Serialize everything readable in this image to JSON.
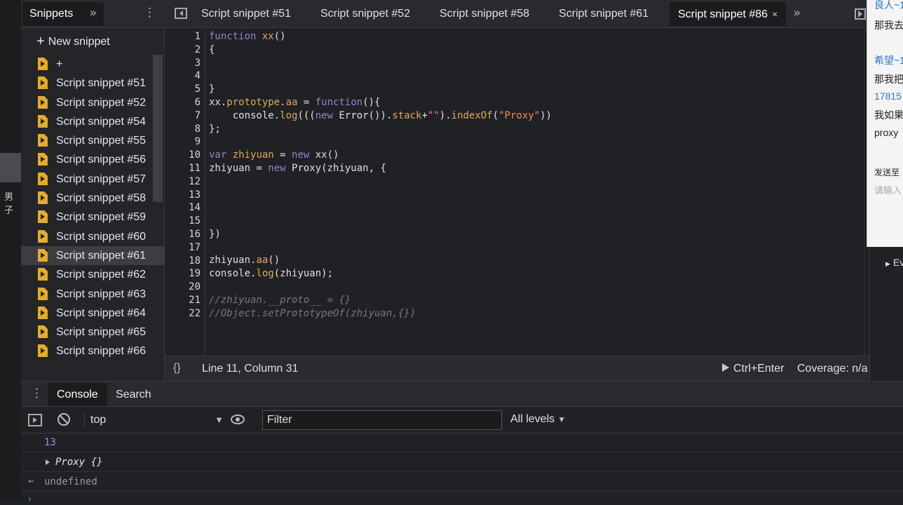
{
  "left_strip": {
    "text": "男子"
  },
  "sidebar": {
    "tab_label": "Snippets",
    "more_label": "»",
    "menu_label": "⋮",
    "new_snippet_label": "New snippet",
    "new_snippet_plus": "+",
    "items": [
      {
        "label": "+"
      },
      {
        "label": "Script snippet #51"
      },
      {
        "label": "Script snippet #52"
      },
      {
        "label": "Script snippet #54"
      },
      {
        "label": "Script snippet #55"
      },
      {
        "label": "Script snippet #56"
      },
      {
        "label": "Script snippet #57"
      },
      {
        "label": "Script snippet #58"
      },
      {
        "label": "Script snippet #59"
      },
      {
        "label": "Script snippet #60"
      },
      {
        "label": "Script snippet #61"
      },
      {
        "label": "Script snippet #62"
      },
      {
        "label": "Script snippet #63"
      },
      {
        "label": "Script snippet #64"
      },
      {
        "label": "Script snippet #65"
      },
      {
        "label": "Script snippet #66"
      }
    ],
    "active_item": "Script snippet #61"
  },
  "editor_tabs": {
    "tabs": [
      {
        "label": "Script snippet #51"
      },
      {
        "label": "Script snippet #52"
      },
      {
        "label": "Script snippet #58"
      },
      {
        "label": "Script snippet #61"
      },
      {
        "label": "Script snippet #86"
      }
    ],
    "active_tab": "Script snippet #86",
    "close_label": "×",
    "more_label": "»"
  },
  "editor": {
    "line_numbers": [
      "1",
      "2",
      "3",
      "4",
      "5",
      "6",
      "7",
      "8",
      "9",
      "10",
      "11",
      "12",
      "13",
      "14",
      "15",
      "16",
      "17",
      "18",
      "19",
      "20",
      "21",
      "22"
    ],
    "code": {
      "l1_kw": "function",
      "l1_name": " xx",
      "l1_rest": "()",
      "l2": "{",
      "l5": "}",
      "l6_obj": "xx.",
      "l6_prop": "prototype",
      "l6_dot": ".",
      "l6_aa": "aa",
      "l6_eq": " = ",
      "l6_fn": "function",
      "l6_rest": "(){",
      "l7_a": "    console.",
      "l7_log": "log",
      "l7_b": "(((",
      "l7_new": "new",
      "l7_c": " Error()).",
      "l7_stack": "stack",
      "l7_d": "+",
      "l7_s1": "\"\"",
      "l7_e": ").",
      "l7_idx": "indexOf",
      "l7_f": "(",
      "l7_s2": "\"Proxy\"",
      "l7_g": "))",
      "l8": "};",
      "l10_var": "var",
      "l10_name": " zhiyuan",
      "l10_eq": " = ",
      "l10_new": "new",
      "l10_rest": " xx()",
      "l11_a": "zhiyuan = ",
      "l11_new": "new",
      "l11_b": " Proxy(zhiyuan, {",
      "l16": "})",
      "l18_a": "zhiyuan.",
      "l18_aa": "aa",
      "l18_b": "()",
      "l19_a": "console.",
      "l19_log": "log",
      "l19_b": "(zhiyuan);",
      "l21": "//zhiyuan.__proto__ = {}",
      "l22": "//Object.setPrototypeOf(zhiyuan,{})"
    }
  },
  "statusbar": {
    "pretty_label": "{}",
    "cursor": "Line 11, Column 31",
    "run_label": "Ctrl+Enter",
    "coverage": "Coverage: n/a"
  },
  "chat": {
    "lines": [
      "良人~1",
      "那我去",
      "希望~1",
      "那我把",
      "17815",
      "我如果",
      "proxy",
      "发送至",
      "请输入"
    ]
  },
  "right_panel": {
    "label": "Ev"
  },
  "drawer": {
    "menu_label": "⋮",
    "tabs": [
      {
        "label": "Console"
      },
      {
        "label": "Search"
      }
    ],
    "active_tab": "Console"
  },
  "console_toolbar": {
    "context": "top",
    "context_caret": "▼",
    "filter_placeholder": "Filter",
    "levels": "All levels",
    "levels_caret": "▼"
  },
  "console_output": {
    "line1": "13",
    "line2": "Proxy {}",
    "line3_arrow": "←",
    "line3": "undefined",
    "prompt": "›"
  },
  "colors": {
    "accent_file_icon": "#e3ac2a",
    "keyword": "#9a7fd4",
    "function_name": "#e0a960",
    "string": "#f28b54",
    "number_output": "#9d8fe5"
  }
}
